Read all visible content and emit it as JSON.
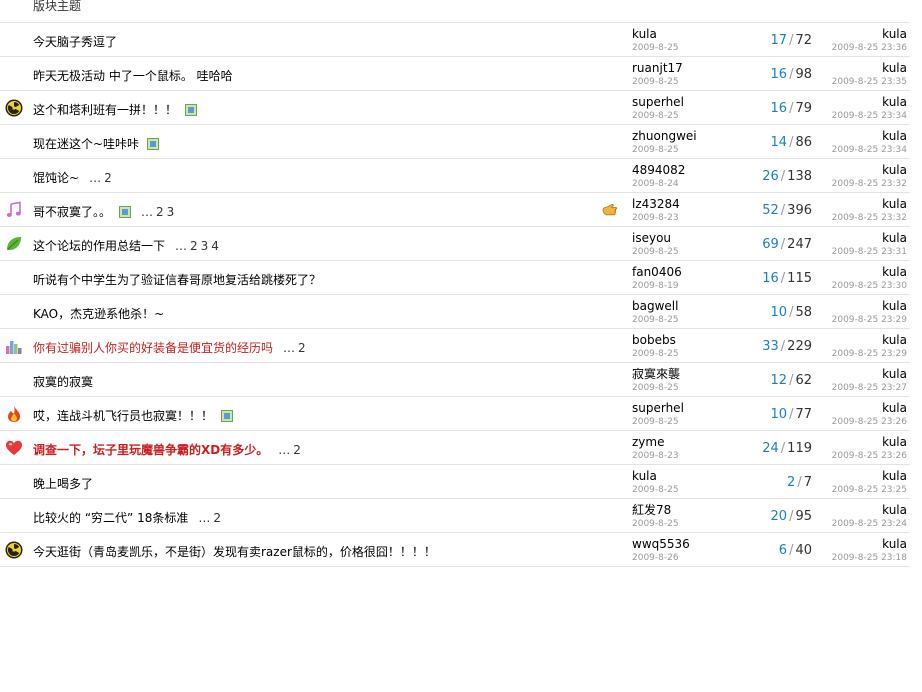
{
  "header": {
    "title": "版块主题"
  },
  "colors": {
    "reply_count": "#1a7fc0",
    "red_title": "#cc1f1f",
    "separator": "#e3e3e3"
  },
  "threads": [
    {
      "title": "今天脑子秀逗了",
      "icon": "",
      "style": "",
      "has_image": false,
      "pages": [],
      "hand": false,
      "author": "kula",
      "date": "2009-8-25",
      "replies": "17",
      "views": "72",
      "last_user": "kula",
      "last_time": "2009-8-25 23:36"
    },
    {
      "title": "昨天无极活动  中了一个鼠标。 哇哈哈",
      "icon": "",
      "style": "",
      "has_image": false,
      "pages": [],
      "hand": false,
      "author": "ruanjt17",
      "date": "2009-8-25",
      "replies": "16",
      "views": "98",
      "last_user": "kula",
      "last_time": "2009-8-25 23:35"
    },
    {
      "title": "这个和塔利班有一拼！！！",
      "icon": "radiation-icon",
      "style": "",
      "has_image": true,
      "pages": [],
      "hand": false,
      "author": "superhel",
      "date": "2009-8-25",
      "replies": "16",
      "views": "79",
      "last_user": "kula",
      "last_time": "2009-8-25 23:34"
    },
    {
      "title": "现在迷这个~哇咔咔",
      "icon": "",
      "style": "",
      "has_image": true,
      "pages": [],
      "hand": false,
      "author": "zhuongwei",
      "date": "2009-8-25",
      "replies": "14",
      "views": "86",
      "last_user": "kula",
      "last_time": "2009-8-25 23:34"
    },
    {
      "title": "馄饨论~",
      "icon": "",
      "style": "",
      "has_image": false,
      "pages": [
        "2"
      ],
      "hand": false,
      "author": "4894082",
      "date": "2009-8-24",
      "replies": "26",
      "views": "138",
      "last_user": "kula",
      "last_time": "2009-8-25 23:32"
    },
    {
      "title": "哥不寂寞了。。",
      "icon": "music-note-icon",
      "style": "",
      "has_image": true,
      "pages": [
        "2",
        "3"
      ],
      "hand": true,
      "author": "lz43284",
      "date": "2009-8-23",
      "replies": "52",
      "views": "396",
      "last_user": "kula",
      "last_time": "2009-8-25 23:32"
    },
    {
      "title": "这个论坛的作用总结一下",
      "icon": "leaf-icon",
      "style": "",
      "has_image": false,
      "pages": [
        "2",
        "3",
        "4"
      ],
      "hand": false,
      "author": "iseyou",
      "date": "2009-8-25",
      "replies": "69",
      "views": "247",
      "last_user": "kula",
      "last_time": "2009-8-25 23:31"
    },
    {
      "title": "听说有个中学生为了验证信春哥原地复活给跳楼死了？",
      "icon": "",
      "style": "",
      "has_image": false,
      "pages": [],
      "hand": false,
      "author": "fan0406",
      "date": "2009-8-19",
      "replies": "16",
      "views": "115",
      "last_user": "kula",
      "last_time": "2009-8-25 23:30"
    },
    {
      "title": "KAO，杰克逊系他杀！~",
      "icon": "",
      "style": "",
      "has_image": false,
      "pages": [],
      "hand": false,
      "author": "bagwell",
      "date": "2009-8-25",
      "replies": "10",
      "views": "58",
      "last_user": "kula",
      "last_time": "2009-8-25 23:29"
    },
    {
      "title": "你有过骗别人你买的好装备是便宜货的经历吗",
      "icon": "bar-chart-icon",
      "style": "red",
      "has_image": false,
      "pages": [
        "2"
      ],
      "hand": false,
      "author": "bobebs",
      "date": "2009-8-25",
      "replies": "33",
      "views": "229",
      "last_user": "kula",
      "last_time": "2009-8-25 23:29"
    },
    {
      "title": "寂寞的寂寞",
      "icon": "",
      "style": "",
      "has_image": false,
      "pages": [],
      "hand": false,
      "author": "寂寞來襲",
      "date": "2009-8-25",
      "replies": "12",
      "views": "62",
      "last_user": "kula",
      "last_time": "2009-8-25 23:27"
    },
    {
      "title": "哎，连战斗机飞行员也寂寞！！！",
      "icon": "fire-icon",
      "style": "",
      "has_image": true,
      "pages": [],
      "hand": false,
      "author": "superhel",
      "date": "2009-8-25",
      "replies": "10",
      "views": "77",
      "last_user": "kula",
      "last_time": "2009-8-25 23:26"
    },
    {
      "title": "调查一下，坛子里玩魔兽争霸的XD有多少。",
      "icon": "heart-icon",
      "style": "red-bold",
      "has_image": false,
      "pages": [
        "2"
      ],
      "hand": false,
      "author": "zyme",
      "date": "2009-8-23",
      "replies": "24",
      "views": "119",
      "last_user": "kula",
      "last_time": "2009-8-25 23:26"
    },
    {
      "title": "晚上喝多了",
      "icon": "",
      "style": "",
      "has_image": false,
      "pages": [],
      "hand": false,
      "author": "kula",
      "date": "2009-8-25",
      "replies": "2",
      "views": "7",
      "last_user": "kula",
      "last_time": "2009-8-25 23:25"
    },
    {
      "title": "比较火的 “穷二代” 18条标准",
      "icon": "",
      "style": "",
      "has_image": false,
      "pages": [
        "2"
      ],
      "hand": false,
      "author": "紅发78",
      "date": "2009-8-25",
      "replies": "20",
      "views": "95",
      "last_user": "kula",
      "last_time": "2009-8-25 23:24"
    },
    {
      "title": "今天逛街（青岛麦凯乐，不是街）发现有卖razer鼠标的，价格很囧！！！！",
      "icon": "radiation-icon",
      "style": "",
      "has_image": false,
      "pages": [],
      "hand": false,
      "author": "wwq5536",
      "date": "2009-8-26",
      "replies": "6",
      "views": "40",
      "last_user": "kula",
      "last_time": "2009-8-25 23:18"
    }
  ]
}
